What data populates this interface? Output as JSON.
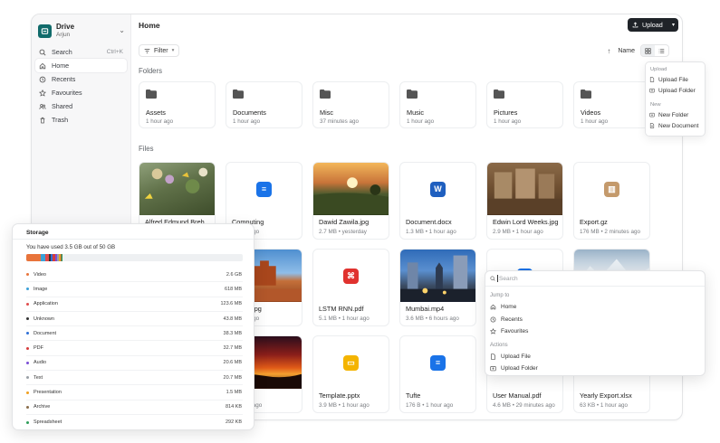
{
  "sidebar": {
    "brand_title": "Drive",
    "brand_user": "Arjun",
    "search_label": "Search",
    "search_shortcut": "Ctrl+K",
    "items": [
      {
        "label": "Home",
        "icon": "home-icon",
        "active": true
      },
      {
        "label": "Recents",
        "icon": "clock-icon"
      },
      {
        "label": "Favourites",
        "icon": "star-icon"
      },
      {
        "label": "Shared",
        "icon": "users-icon"
      },
      {
        "label": "Trash",
        "icon": "trash-icon"
      }
    ]
  },
  "header": {
    "title": "Home",
    "upload_label": "Upload"
  },
  "toolbar": {
    "filter_label": "Filter",
    "sort_label": "Name"
  },
  "sections": {
    "folders": "Folders",
    "files": "Files"
  },
  "folders": [
    {
      "name": "Assets",
      "meta": "1 hour ago"
    },
    {
      "name": "Documents",
      "meta": "1 hour ago"
    },
    {
      "name": "Misc",
      "meta": "37 minutes ago"
    },
    {
      "name": "Music",
      "meta": "1 hour ago"
    },
    {
      "name": "Pictures",
      "meta": "1 hour ago"
    },
    {
      "name": "Videos",
      "meta": "1 hour ago"
    }
  ],
  "files": [
    {
      "name": "Alfred Edmund Breh...",
      "meta": "",
      "thumb": "image-flowers"
    },
    {
      "name": "Computing",
      "meta": "1 hour ago",
      "thumb": "doc-icon"
    },
    {
      "name": "Dawid Zawila.jpg",
      "meta": "2.7 MB • yesterday",
      "thumb": "image-sunset-field"
    },
    {
      "name": "Document.docx",
      "meta": "1.3 MB • 1 hour ago",
      "thumb": "word-icon"
    },
    {
      "name": "Edwin Lord Weeks.jpg",
      "meta": "2.9 MB • 1 hour ago",
      "thumb": "image-painting"
    },
    {
      "name": "Export.gz",
      "meta": "176 MB • 2 minutes ago",
      "thumb": "archive-icon"
    },
    {
      "name": "...alles.jpg",
      "meta": "1 hour ago",
      "thumb": "image-monument-valley"
    },
    {
      "name": "LSTM RNN.pdf",
      "meta": "5.1 MB • 1 hour ago",
      "thumb": "pdf-icon"
    },
    {
      "name": "Mumbai.mp4",
      "meta": "3.6 MB • 6 hours ago",
      "thumb": "image-city-night"
    },
    {
      "name": "",
      "meta": "",
      "thumb": "video-blue"
    },
    {
      "name": "",
      "meta": "",
      "thumb": "image-mountains"
    },
    {
      "name": "...p4",
      "meta": "6 hours ago",
      "thumb": "image-red-sunset"
    },
    {
      "name": "Template.pptx",
      "meta": "3.9 MB • 1 hour ago",
      "thumb": "slides-icon"
    },
    {
      "name": "Tufte",
      "meta": "176 B • 1 hour ago",
      "thumb": "doc-icon"
    },
    {
      "name": "User Manual.pdf",
      "meta": "4.6 MB • 29 minutes ago",
      "thumb": "blank"
    },
    {
      "name": "Yearly Export.xlsx",
      "meta": "63 KB • 1 hour ago",
      "thumb": "blank"
    }
  ],
  "upload_menu": {
    "group1": "Upload",
    "item1": "Upload File",
    "item2": "Upload Folder",
    "group2": "New",
    "item3": "New Folder",
    "item4": "New Document"
  },
  "storage": {
    "title": "Storage",
    "used_text": "You have used 3.5 GB out of 50 GB",
    "used_fraction": 0.07,
    "rows": [
      {
        "label": "Video",
        "size": "2.6 GB",
        "color": "#e8743b"
      },
      {
        "label": "Image",
        "size": "618 MB",
        "color": "#3aa0d8"
      },
      {
        "label": "Application",
        "size": "123.6 MB",
        "color": "#e04b4b"
      },
      {
        "label": "Unknown",
        "size": "43.8 MB",
        "color": "#333333"
      },
      {
        "label": "Document",
        "size": "38.3 MB",
        "color": "#2f6fd6"
      },
      {
        "label": "PDF",
        "size": "32.7 MB",
        "color": "#d63b3b"
      },
      {
        "label": "Audio",
        "size": "20.6 MB",
        "color": "#7b4fd6"
      },
      {
        "label": "Text",
        "size": "20.7 MB",
        "color": "#9aa0a6"
      },
      {
        "label": "Presentation",
        "size": "1.5 MB",
        "color": "#f0a020"
      },
      {
        "label": "Archive",
        "size": "814 KB",
        "color": "#8a6d4a"
      },
      {
        "label": "Spreadsheet",
        "size": "292 KB",
        "color": "#2e9e5a"
      }
    ]
  },
  "palette": {
    "placeholder": "Search",
    "group1": "Jump to",
    "jump": [
      "Home",
      "Recents",
      "Favourites"
    ],
    "group2": "Actions",
    "actions": [
      "Upload File",
      "Upload Folder"
    ]
  },
  "colors": {
    "brand": "#116b6b",
    "primary_button": "#1f2328",
    "doc_blue": "#1a73e8",
    "word_blue": "#1f5fbf",
    "pdf_red": "#e0322e",
    "slides_yellow": "#f4b400",
    "archive_tan": "#c49a6c"
  }
}
